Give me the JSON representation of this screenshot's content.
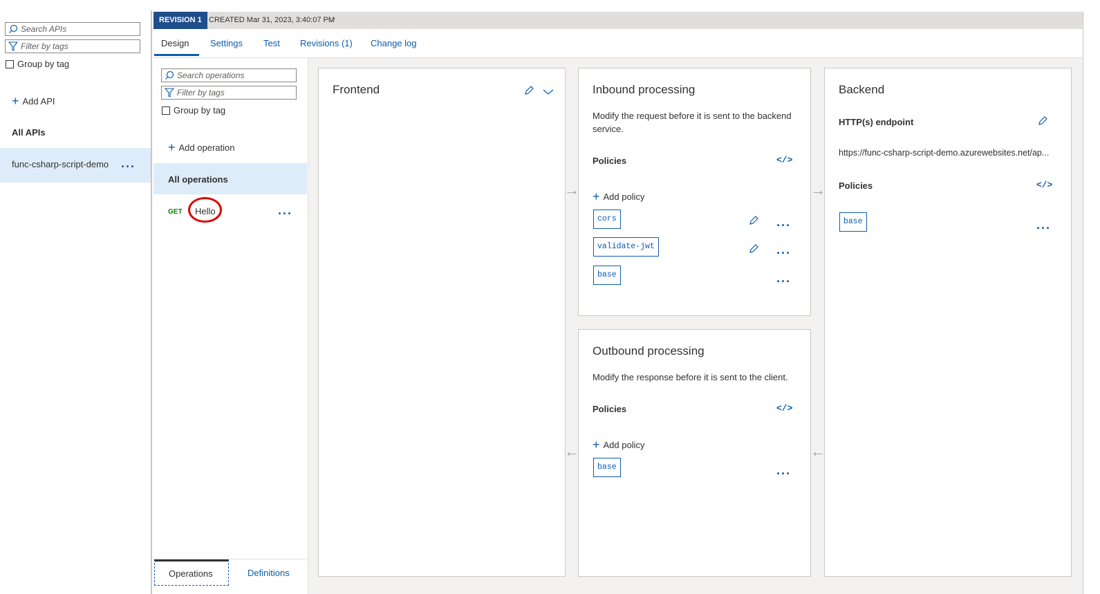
{
  "left": {
    "search_placeholder": "Search APIs",
    "filter_placeholder": "Filter by tags",
    "group_by_tag": "Group by tag",
    "add_api": "Add API",
    "all_apis": "All APIs",
    "api_name": "func-csharp-script-demo"
  },
  "revision": {
    "badge": "REVISION 1",
    "created": "CREATED Mar 31, 2023, 3:40:07 PM"
  },
  "tabs": [
    "Design",
    "Settings",
    "Test",
    "Revisions (1)",
    "Change log"
  ],
  "ops": {
    "search_placeholder": "Search operations",
    "filter_placeholder": "Filter by tags",
    "group_by_tag": "Group by tag",
    "add_operation": "Add operation",
    "all_operations": "All operations",
    "op_method": "GET",
    "op_name": "Hello",
    "bottom_tab_operations": "Operations",
    "bottom_tab_definitions": "Definitions"
  },
  "frontend": {
    "title": "Frontend"
  },
  "inbound": {
    "title": "Inbound processing",
    "description": "Modify the request before it is sent to the backend service.",
    "policies_label": "Policies",
    "add_policy": "Add policy",
    "policies": [
      "cors",
      "validate-jwt",
      "base"
    ]
  },
  "outbound": {
    "title": "Outbound processing",
    "description": "Modify the response before it is sent to the client.",
    "policies_label": "Policies",
    "add_policy": "Add policy",
    "policies": [
      "base"
    ]
  },
  "backend": {
    "title": "Backend",
    "endpoint_label": "HTTP(s) endpoint",
    "endpoint_url": "https://func-csharp-script-demo.azurewebsites.net/ap...",
    "policies_label": "Policies",
    "policies": [
      "base"
    ]
  },
  "colors": {
    "accent": "#0b5cad",
    "badge_bg": "#1f4e8c",
    "selected_bg": "#deecf9",
    "annotation": "#e00000"
  }
}
